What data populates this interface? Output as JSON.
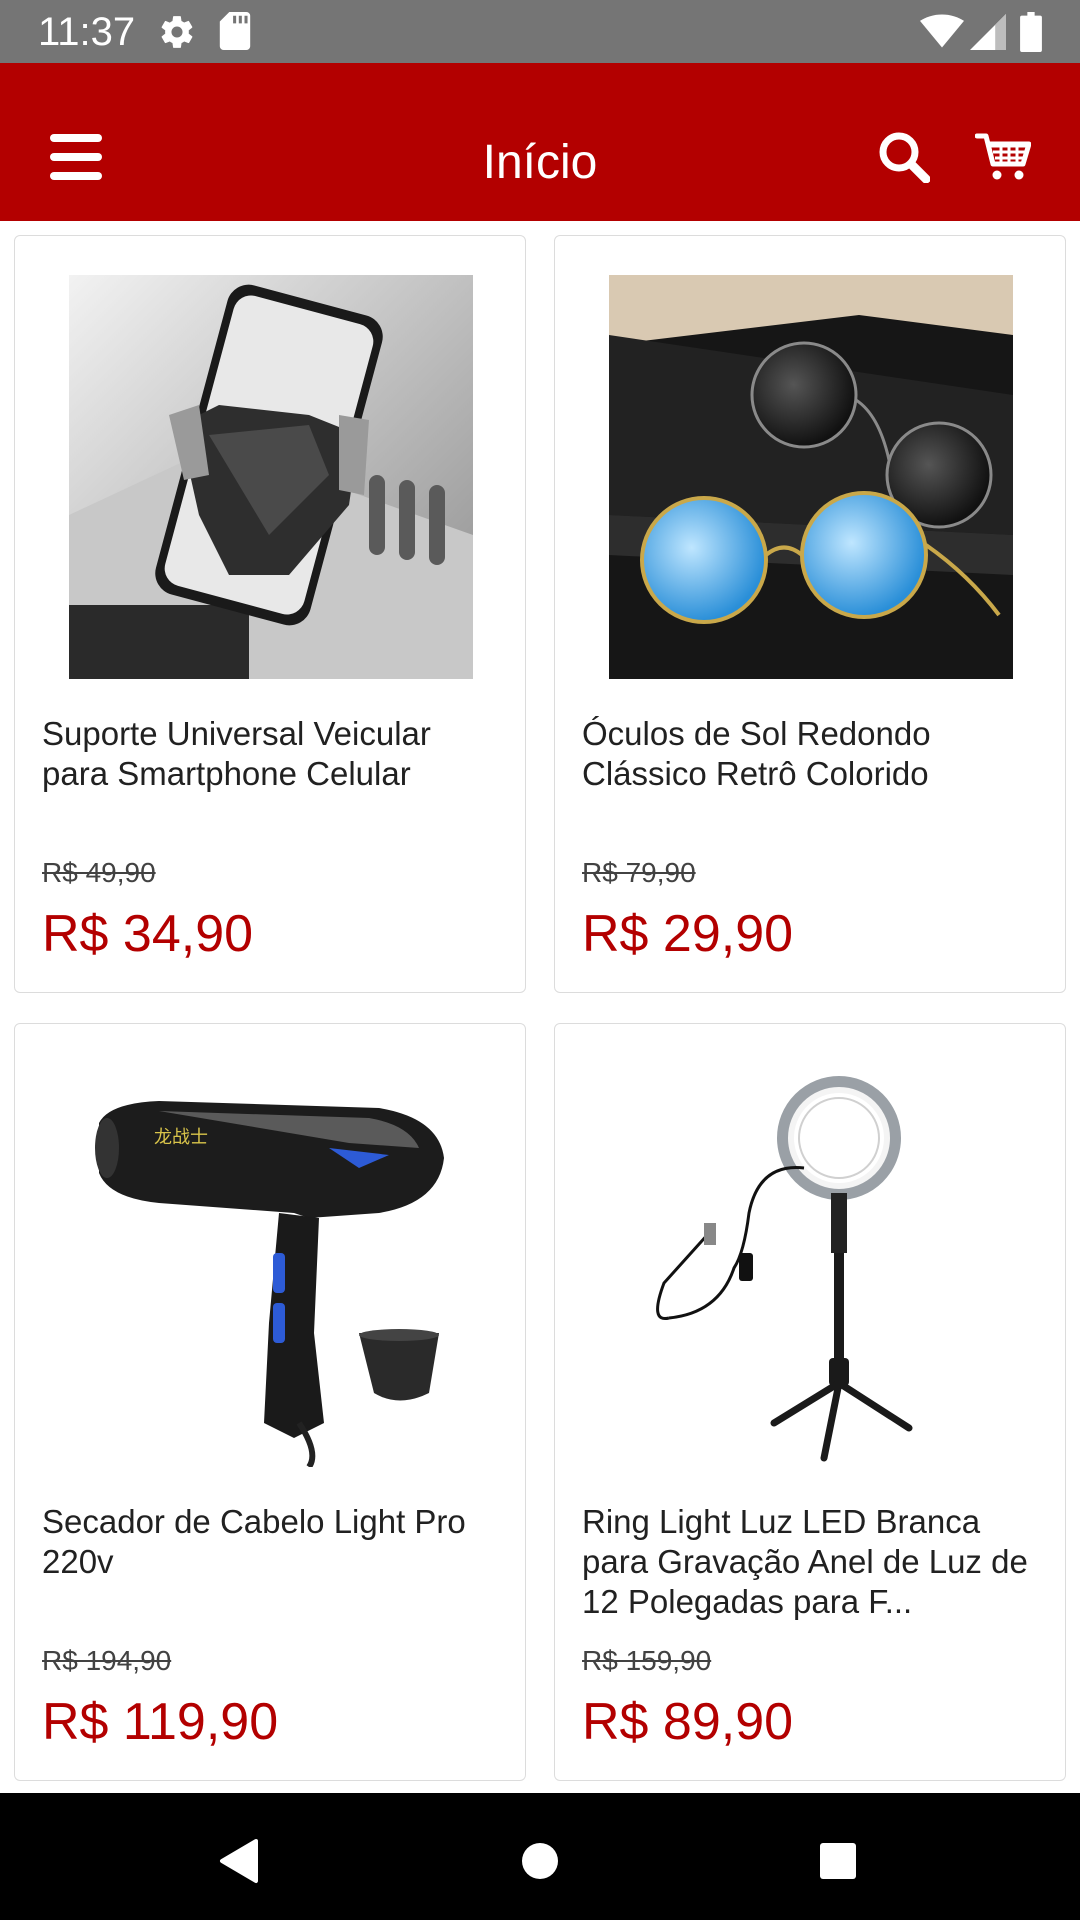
{
  "status_bar": {
    "time": "11:37",
    "icons": [
      "settings-icon",
      "sd-card-icon",
      "wifi-icon",
      "signal-icon",
      "battery-icon"
    ]
  },
  "app_bar": {
    "title": "Início",
    "menu_icon": "menu-icon",
    "search_icon": "search-icon",
    "cart_icon": "cart-icon",
    "background": "#b30000"
  },
  "products": [
    {
      "name": "Suporte Universal Veicular para Smartphone Celular",
      "old_price": "R$ 49,90",
      "price": "R$ 34,90",
      "image": "car-phone-holder"
    },
    {
      "name": "Óculos de Sol Redondo Clássico Retrô Colorido",
      "old_price": "R$ 79,90",
      "price": "R$ 29,90",
      "image": "round-sunglasses"
    },
    {
      "name": "Secador de Cabelo Light Pro 220v",
      "old_price": "R$ 194,90",
      "price": "R$ 119,90",
      "image": "hair-dryer"
    },
    {
      "name": "Ring Light Luz LED Branca para Gravação Anel de Luz de 12 Polegadas para F...",
      "old_price": "R$ 159,90",
      "price": "R$ 89,90",
      "image": "ring-light"
    }
  ],
  "colors": {
    "accent": "#b30000",
    "price": "#b30000",
    "status_bar": "#757575",
    "nav_bar": "#000000"
  },
  "nav_bar": {
    "icons": [
      "back-icon",
      "home-icon",
      "recents-icon"
    ]
  }
}
